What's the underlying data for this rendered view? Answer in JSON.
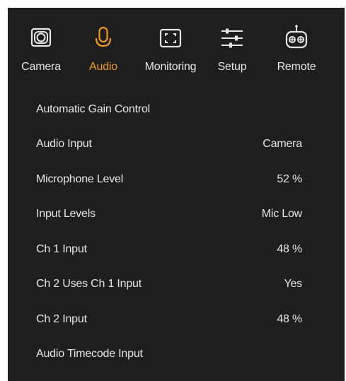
{
  "tabs": [
    {
      "label": "Camera",
      "icon": "camera-icon",
      "active": false
    },
    {
      "label": "Audio",
      "icon": "microphone-icon",
      "active": true
    },
    {
      "label": "Monitoring",
      "icon": "frame-guides-icon",
      "active": false
    },
    {
      "label": "Setup",
      "icon": "sliders-icon",
      "active": false
    },
    {
      "label": "Remote",
      "icon": "remote-control-icon",
      "active": false
    }
  ],
  "settings": [
    {
      "label": "Automatic Gain Control",
      "value": ""
    },
    {
      "label": "Audio Input",
      "value": "Camera"
    },
    {
      "label": "Microphone Level",
      "value": "52 %"
    },
    {
      "label": "Input Levels",
      "value": "Mic Low"
    },
    {
      "label": "Ch 1 Input",
      "value": "48 %"
    },
    {
      "label": "Ch 2 Uses Ch 1 Input",
      "value": "Yes"
    },
    {
      "label": "Ch 2 Input",
      "value": "48 %"
    },
    {
      "label": "Audio Timecode Input",
      "value": ""
    }
  ],
  "colors": {
    "background": "#1e1e1e",
    "text": "#e6e6e6",
    "accent": "#f39a1d"
  }
}
